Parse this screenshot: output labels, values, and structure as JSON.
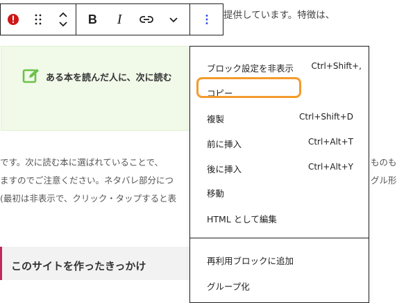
{
  "content": {
    "top_text": "提供しています。特徴は、",
    "callout_text": "ある本を読んだ人に、次に読む",
    "para_lines": [
      "です。次に読む本に選ばれていることで、",
      "ますのでご注意ください。ネタバレ部分につ",
      "(最初は非表示で、クリック・タップすると表"
    ],
    "para_right": [
      "ものも",
      "グル形"
    ],
    "heading": "このサイトを作ったきっかけ"
  },
  "toolbar": {
    "warning_icon": "warning-icon",
    "drag_icon": "drag-handle-icon",
    "move_icon": "move-up-down-icon",
    "bold": "B",
    "italic": "I",
    "link_icon": "link-icon",
    "more_icon": "chevron-down-icon",
    "options_icon": "more-vertical-icon"
  },
  "menu": {
    "items": [
      {
        "label": "ブロック設定を非表示",
        "shortcut": "Ctrl+Shift+,"
      },
      {
        "label": "コピー",
        "shortcut": ""
      },
      {
        "label": "複製",
        "shortcut": "Ctrl+Shift+D"
      },
      {
        "label": "前に挿入",
        "shortcut": "Ctrl+Alt+T"
      },
      {
        "label": "後に挿入",
        "shortcut": "Ctrl+Alt+Y"
      },
      {
        "label": "移動",
        "shortcut": ""
      },
      {
        "label": "HTML として編集",
        "shortcut": ""
      },
      {
        "label": "再利用ブロックに追加",
        "shortcut": ""
      },
      {
        "label": "グループ化",
        "shortcut": ""
      }
    ]
  },
  "colors": {
    "highlight": "#f59a2c",
    "callout_bg": "#f1f9e9",
    "callout_icon": "#6cc24a",
    "heading_accent": "#c2285a",
    "warning": "#cc1818"
  }
}
